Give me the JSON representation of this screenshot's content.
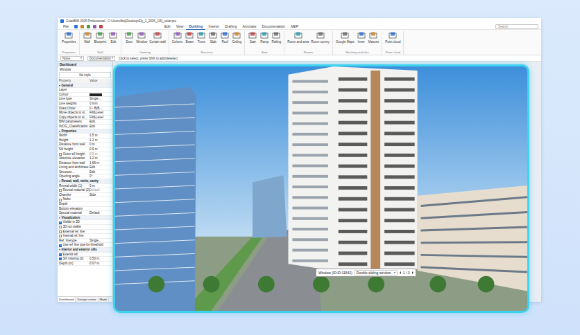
{
  "window": {
    "title": "GstarBIM 2025 Professional - C:\\Users\\lbuj\\Desktop\\Ely_3_2025_(15)_solar.pro"
  },
  "file_menu": "File",
  "menu_tabs": [
    {
      "label": "Edit",
      "selected": false
    },
    {
      "label": "View",
      "selected": false
    },
    {
      "label": "Building",
      "selected": true
    },
    {
      "label": "Interior",
      "selected": false
    },
    {
      "label": "Drafting",
      "selected": false
    },
    {
      "label": "Annotate",
      "selected": false
    },
    {
      "label": "Documentation",
      "selected": false
    },
    {
      "label": "MEP",
      "selected": false
    }
  ],
  "search": {
    "placeholder": "Search"
  },
  "ribbon_groups": [
    {
      "label": "Properties",
      "tools": [
        "Properties"
      ]
    },
    {
      "label": "Wall",
      "tools": [
        "Wall",
        "Blueprint",
        "Edit"
      ]
    },
    {
      "label": "Opening",
      "tools": [
        "Door",
        "Window",
        "Curtain wall"
      ]
    },
    {
      "label": "Structure",
      "tools": [
        "Column",
        "Beam",
        "Truss",
        "Slab",
        "Roof",
        "Ceiling"
      ]
    },
    {
      "label": "Stair",
      "tools": [
        "Stair",
        "Ramp",
        "Railing"
      ]
    },
    {
      "label": "Rooms",
      "tools": [
        "Room and area",
        "Room survey"
      ]
    },
    {
      "label": "Meshing and tiles",
      "tools": [
        "Google Maps",
        "Inner",
        "Masses"
      ]
    },
    {
      "label": "Point cloud",
      "tools": [
        "Point cloud"
      ]
    }
  ],
  "command_bar": {
    "layer": "None",
    "view": "Documentation",
    "hint": "Click to select, press Shift to add/deselect"
  },
  "panel": {
    "title": "Dashboard",
    "object": "Window",
    "style": "No style",
    "columns": [
      "Property",
      "Value"
    ],
    "rows": [
      {
        "kind": "section",
        "label": "General"
      },
      {
        "kind": "text",
        "label": "Layer",
        "value": ""
      },
      {
        "kind": "swatch",
        "label": "Colour",
        "color": "#222222"
      },
      {
        "kind": "text",
        "label": "Line type",
        "value": "Single..."
      },
      {
        "kind": "text",
        "label": "Line weights",
        "value": "0 mm"
      },
      {
        "kind": "text",
        "label": "Draw Order",
        "value": "0 - B(B..."
      },
      {
        "kind": "text",
        "label": "Move objects to st...",
        "value": "Fill&Level"
      },
      {
        "kind": "text",
        "label": "Copy objects to st...",
        "value": "Fill&Level"
      },
      {
        "kind": "text",
        "label": "BIM parameters",
        "value": "Edit"
      },
      {
        "kind": "text",
        "label": "IfcOG_Classification",
        "value": "Edit"
      },
      {
        "kind": "section",
        "label": "Properties"
      },
      {
        "kind": "text",
        "label": "Width",
        "value": "1.5 m"
      },
      {
        "kind": "text",
        "label": "Height",
        "value": "1.2 m"
      },
      {
        "kind": "text",
        "label": "Distance from wall",
        "value": "0 m"
      },
      {
        "kind": "text",
        "label": "Sill height",
        "value": "0.9 m"
      },
      {
        "kind": "check",
        "label": "Outer sill height",
        "checked": false,
        "value": "0.9 m"
      },
      {
        "kind": "text",
        "label": "Absolute elevation",
        "value": "1.2 m"
      },
      {
        "kind": "text",
        "label": "Distance from wall",
        "value": "1.65 m"
      },
      {
        "kind": "text",
        "label": "Lining and architrave",
        "value": "Edit"
      },
      {
        "kind": "text",
        "label": "Structure...",
        "value": "Edit"
      },
      {
        "kind": "text",
        "label": "Opening angle",
        "value": "0°"
      },
      {
        "kind": "section",
        "label": "Reveal, wall, niche, cavity"
      },
      {
        "kind": "text",
        "label": "Reveal width (1)",
        "value": "0 m"
      },
      {
        "kind": "check",
        "label": "Reveal material (2)",
        "checked": false,
        "value": "Default"
      },
      {
        "kind": "text",
        "label": "Chamfer",
        "value": "Side"
      },
      {
        "kind": "check",
        "label": "Niche",
        "checked": false,
        "value": ""
      },
      {
        "kind": "text",
        "label": "Depth",
        "value": ""
      },
      {
        "kind": "text",
        "label": "Bottom elevation",
        "value": ""
      },
      {
        "kind": "text",
        "label": "Special material",
        "value": "Default"
      },
      {
        "kind": "section",
        "label": "Visualization"
      },
      {
        "kind": "check",
        "label": "Visible in 3D",
        "checked": true,
        "value": ""
      },
      {
        "kind": "check",
        "label": "3D not visible",
        "checked": false,
        "value": ""
      },
      {
        "kind": "check",
        "label": "External ref. line",
        "checked": false,
        "value": ""
      },
      {
        "kind": "check",
        "label": "Internal ref. line",
        "checked": false,
        "value": ""
      },
      {
        "kind": "text",
        "label": "Ref. linetype",
        "value": "Single..."
      },
      {
        "kind": "check",
        "label": "Use ref. line type for threshold",
        "checked": true,
        "value": ""
      },
      {
        "kind": "section",
        "label": "Interior and exterior sills"
      },
      {
        "kind": "check",
        "label": "Exterior sill",
        "checked": true,
        "value": ""
      },
      {
        "kind": "check",
        "label": "Sill missing (2)",
        "checked": true,
        "value": "0.50 m"
      },
      {
        "kind": "text",
        "label": "Depth (m)",
        "value": "0.07 m"
      }
    ]
  },
  "bottom_tabs": [
    {
      "label": "Dashboard",
      "selected": true
    },
    {
      "label": "Design center",
      "selected": false
    },
    {
      "label": "Mydo",
      "selected": false
    }
  ],
  "viewport": {
    "tooltip": {
      "label": "Window (ID:ID:11542)",
      "type": "Double sliding window",
      "pager": "1 / 3"
    }
  }
}
